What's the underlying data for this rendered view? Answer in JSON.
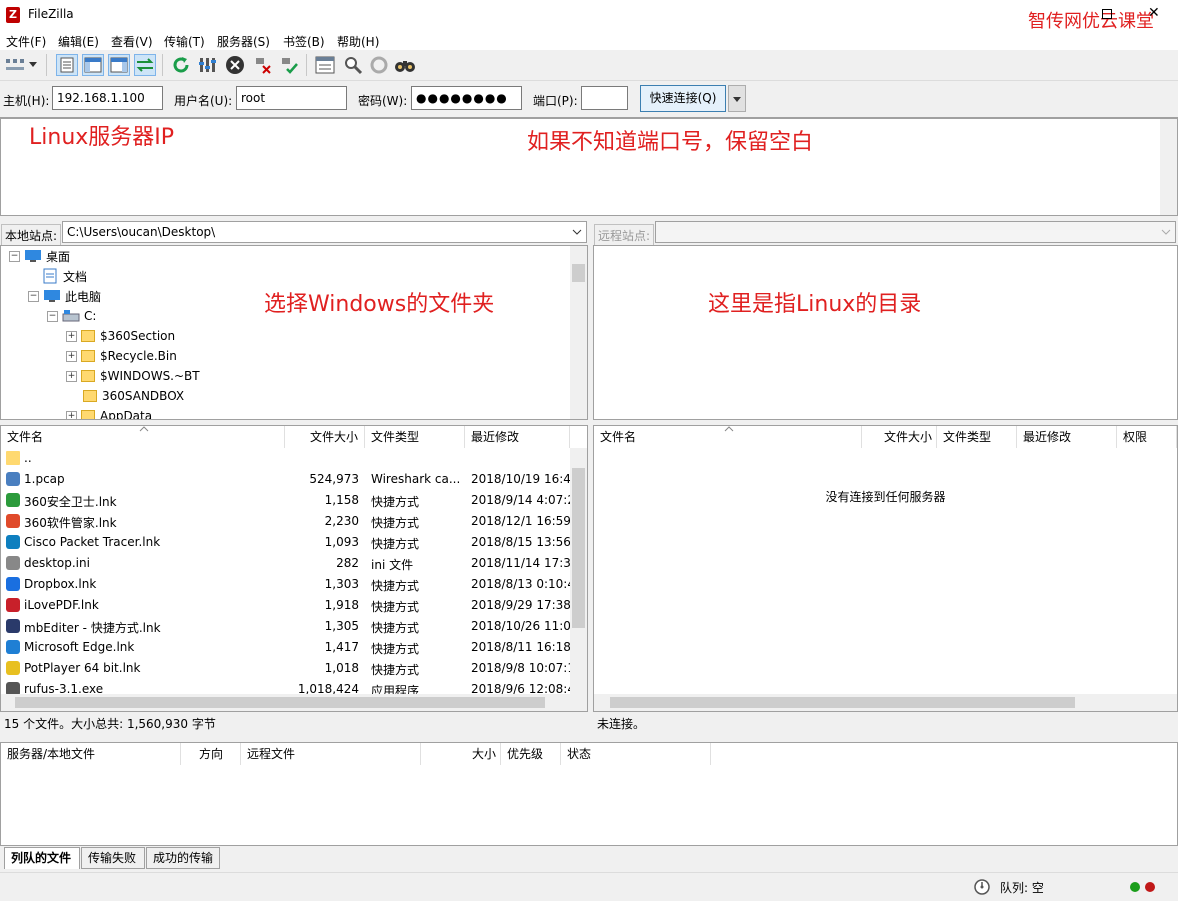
{
  "window": {
    "title": "FileZilla",
    "watermark": "智传网优云课堂"
  },
  "menu": [
    "文件(F)",
    "编辑(E)",
    "查看(V)",
    "传输(T)",
    "服务器(S)",
    "书签(B)",
    "帮助(H)"
  ],
  "quickconnect": {
    "host_label": "主机(H):",
    "host_value": "192.168.1.100",
    "user_label": "用户名(U):",
    "user_value": "root",
    "pass_label": "密码(W):",
    "pass_value": "●●●●●●●●",
    "port_label": "端口(P):",
    "port_value": "",
    "button_label": "快速连接(Q)"
  },
  "annotations": {
    "server_ip": "Linux服务器IP",
    "port_hint": "如果不知道端口号，保留空白",
    "local_hint": "选择Windows的文件夹",
    "remote_hint": "这里是指Linux的目录"
  },
  "local_site": {
    "label": "本地站点:",
    "path": "C:\\Users\\oucan\\Desktop\\"
  },
  "remote_site": {
    "label": "远程站点:",
    "path": ""
  },
  "local_tree": [
    {
      "label": "桌面"
    },
    {
      "label": "文档"
    },
    {
      "label": "此电脑"
    },
    {
      "label": "C:"
    },
    {
      "label": "$360Section"
    },
    {
      "label": "$Recycle.Bin"
    },
    {
      "label": "$WINDOWS.~BT"
    },
    {
      "label": "360SANDBOX"
    },
    {
      "label": "AppData"
    }
  ],
  "local_columns": [
    "文件名",
    "文件大小",
    "文件类型",
    "最近修改"
  ],
  "local_files": [
    {
      "name": "..",
      "size": "",
      "type": "",
      "modified": ""
    },
    {
      "name": "1.pcap",
      "size": "524,973",
      "type": "Wireshark ca...",
      "modified": "2018/10/19 16:4..."
    },
    {
      "name": "360安全卫士.lnk",
      "size": "1,158",
      "type": "快捷方式",
      "modified": "2018/9/14 4:07:2("
    },
    {
      "name": "360软件管家.lnk",
      "size": "2,230",
      "type": "快捷方式",
      "modified": "2018/12/1 16:59:."
    },
    {
      "name": "Cisco Packet Tracer.lnk",
      "size": "1,093",
      "type": "快捷方式",
      "modified": "2018/8/15 13:56:."
    },
    {
      "name": "desktop.ini",
      "size": "282",
      "type": "ini 文件",
      "modified": "2018/11/14 17:3..."
    },
    {
      "name": "Dropbox.lnk",
      "size": "1,303",
      "type": "快捷方式",
      "modified": "2018/8/13 0:10:4"
    },
    {
      "name": "iLovePDF.lnk",
      "size": "1,918",
      "type": "快捷方式",
      "modified": "2018/9/29 17:38:."
    },
    {
      "name": "mbEditer - 快捷方式.lnk",
      "size": "1,305",
      "type": "快捷方式",
      "modified": "2018/10/26 11:0..."
    },
    {
      "name": "Microsoft Edge.lnk",
      "size": "1,417",
      "type": "快捷方式",
      "modified": "2018/8/11 16:18:."
    },
    {
      "name": "PotPlayer 64 bit.lnk",
      "size": "1,018",
      "type": "快捷方式",
      "modified": "2018/9/8 10:07:1"
    },
    {
      "name": "rufus-3.1.exe",
      "size": "1,018,424",
      "type": "应用程序",
      "modified": "2018/9/6 12:08:4("
    }
  ],
  "local_status": "15 个文件。大小总共: 1,560,930 字节",
  "remote_columns": [
    "文件名",
    "文件大小",
    "文件类型",
    "最近修改",
    "权限"
  ],
  "remote_empty": "没有连接到任何服务器",
  "remote_status": "未连接。",
  "queue_columns": [
    "服务器/本地文件",
    "方向",
    "远程文件",
    "大小",
    "优先级",
    "状态"
  ],
  "tabs": [
    "列队的文件",
    "传输失败",
    "成功的传输"
  ],
  "queue_status": "队列: 空",
  "colors": {
    "annotation": "#e02020",
    "accent": "#3c7fb1"
  }
}
